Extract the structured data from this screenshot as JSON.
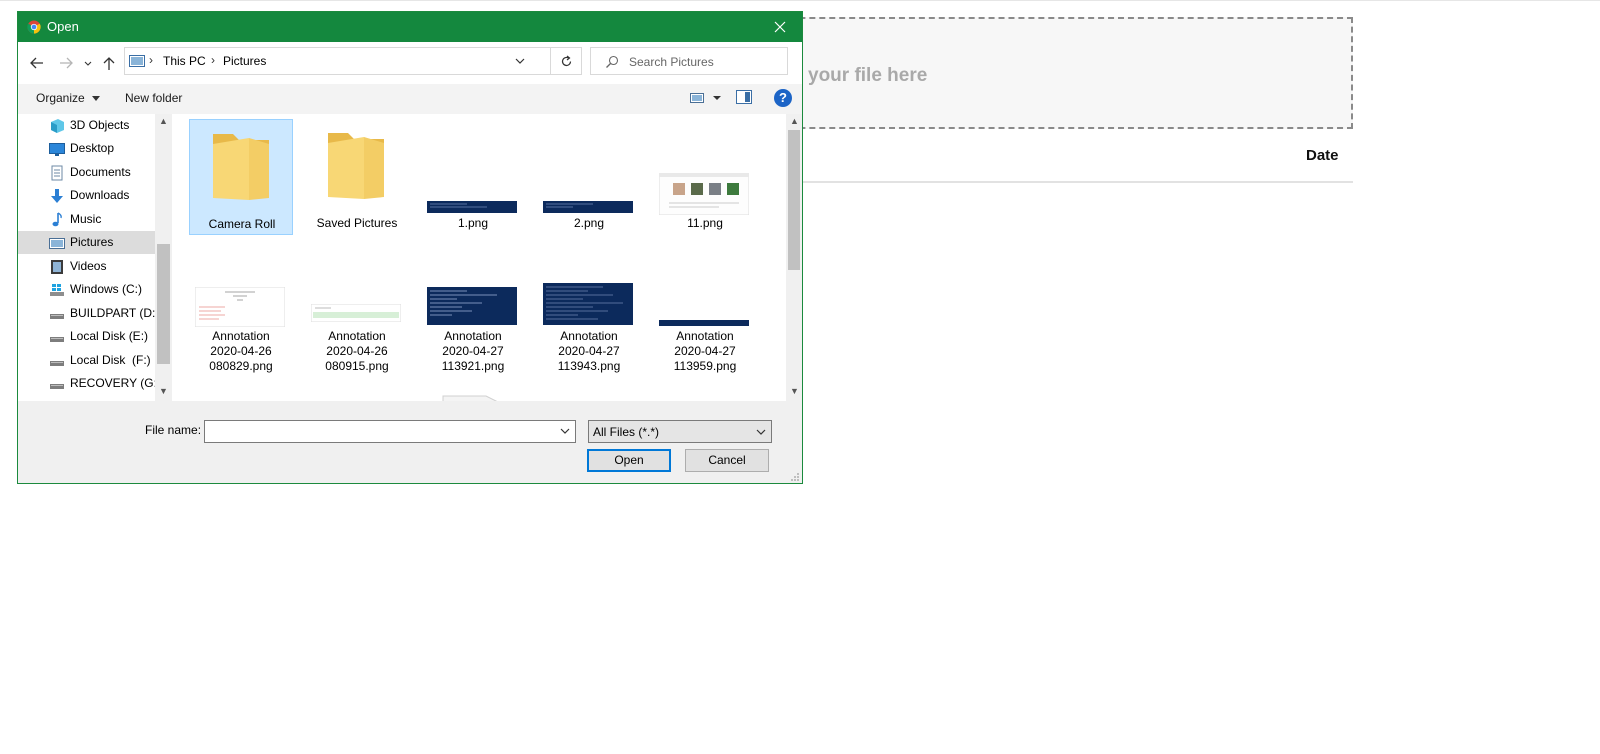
{
  "page": {
    "dropzone_text": "your file here",
    "date_header": "Date"
  },
  "dialog": {
    "title": "Open",
    "address": {
      "breadcrumbs": [
        "This PC",
        "Pictures"
      ]
    },
    "search": {
      "placeholder": "Search Pictures"
    },
    "toolbar": {
      "organize_label": "Organize",
      "new_folder_label": "New folder",
      "help_label": "?"
    },
    "nav_items": [
      {
        "label": "3D Objects",
        "icon": "3d-objects-icon"
      },
      {
        "label": "Desktop",
        "icon": "desktop-icon"
      },
      {
        "label": "Documents",
        "icon": "documents-icon"
      },
      {
        "label": "Downloads",
        "icon": "downloads-icon"
      },
      {
        "label": "Music",
        "icon": "music-icon"
      },
      {
        "label": "Pictures",
        "icon": "pictures-icon",
        "selected": true
      },
      {
        "label": "Videos",
        "icon": "videos-icon"
      },
      {
        "label": "Windows (C:)",
        "icon": "windows-drive-icon"
      },
      {
        "label": "BUILDPART (D:)",
        "icon": "drive-icon"
      },
      {
        "label": "Local Disk (E:)",
        "icon": "drive-icon"
      },
      {
        "label": "Local Disk  (F:)",
        "icon": "drive-icon"
      },
      {
        "label": "RECOVERY (G:)",
        "icon": "drive-icon"
      }
    ],
    "files": [
      {
        "name": "Camera Roll",
        "kind": "folder",
        "selected": true
      },
      {
        "name": "Saved Pictures",
        "kind": "folder"
      },
      {
        "name": "1.png",
        "kind": "image"
      },
      {
        "name": "2.png",
        "kind": "image"
      },
      {
        "name": "11.png",
        "kind": "image"
      },
      {
        "name_lines": [
          "Annotation",
          "2020-04-26",
          "080829.png"
        ],
        "kind": "image"
      },
      {
        "name_lines": [
          "Annotation",
          "2020-04-26",
          "080915.png"
        ],
        "kind": "image"
      },
      {
        "name_lines": [
          "Annotation",
          "2020-04-27",
          "113921.png"
        ],
        "kind": "image"
      },
      {
        "name_lines": [
          "Annotation",
          "2020-04-27",
          "113943.png"
        ],
        "kind": "image"
      },
      {
        "name_lines": [
          "Annotation",
          "2020-04-27",
          "113959.png"
        ],
        "kind": "image"
      }
    ],
    "file_name": {
      "label": "File name:",
      "value": ""
    },
    "file_type": {
      "selected": "All Files (*.*)"
    },
    "open_label": "Open",
    "cancel_label": "Cancel",
    "colors": {
      "titlebar": "#14883e",
      "selection": "#cce8ff",
      "accent": "#0078d7"
    }
  }
}
